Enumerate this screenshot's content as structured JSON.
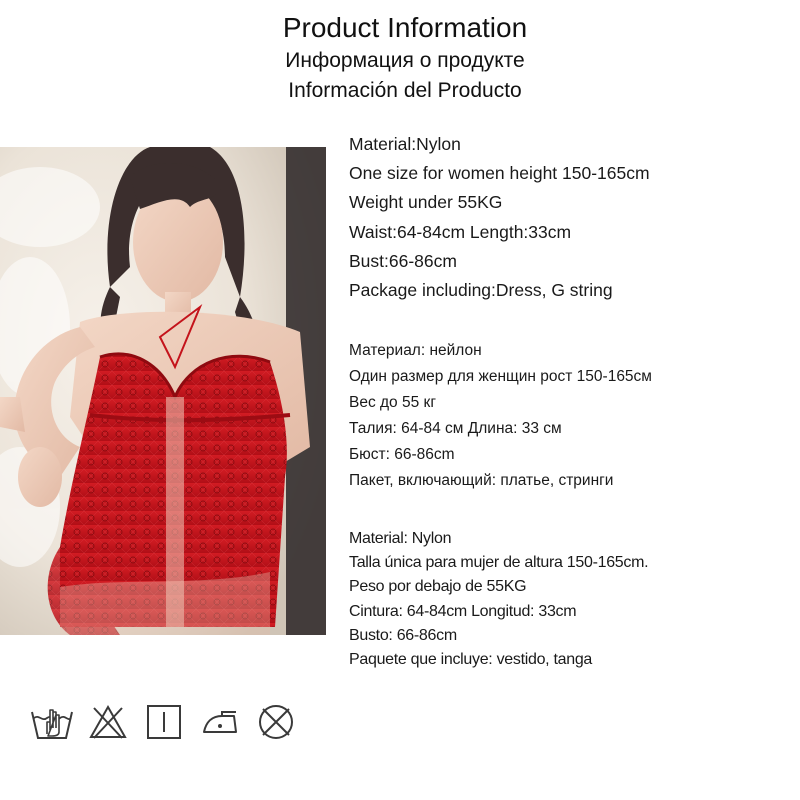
{
  "header": {
    "title": "Product Information",
    "title_ru": "Информация о продукте",
    "title_es": "Información del Producto"
  },
  "specs_en": [
    "Material:Nylon",
    "One size for women height 150-165cm",
    "Weight under 55KG",
    "Waist:64-84cm  Length:33cm",
    "Bust:66-86cm",
    "Package including:Dress, G string"
  ],
  "specs_ru": [
    "Материал: нейлон",
    "Один размер для женщин рост 150-165см",
    "Вес до 55 кг",
    "Талия: 64-84 см Длина: 33 см",
    "Бюст: 66-86cm",
    "Пакет, включающий: платье, стринги"
  ],
  "specs_es": [
    "Material: Nylon",
    "Talla única para mujer de altura 150-165cm.",
    "Peso por debajo de 55KG",
    "Cintura: 64-84cm Longitud: 33cm",
    "Busto: 66-86cm",
    "Paquete que incluye: vestido, tanga"
  ],
  "care_icons": [
    "hand-wash-icon",
    "do-not-bleach-icon",
    "line-dry-icon",
    "low-iron-icon",
    "do-not-dry-clean-icon"
  ],
  "colors": {
    "text": "#111111",
    "garment": "#c4131b",
    "background": "#ffffff",
    "icon_stroke": "#3a3a3a"
  }
}
